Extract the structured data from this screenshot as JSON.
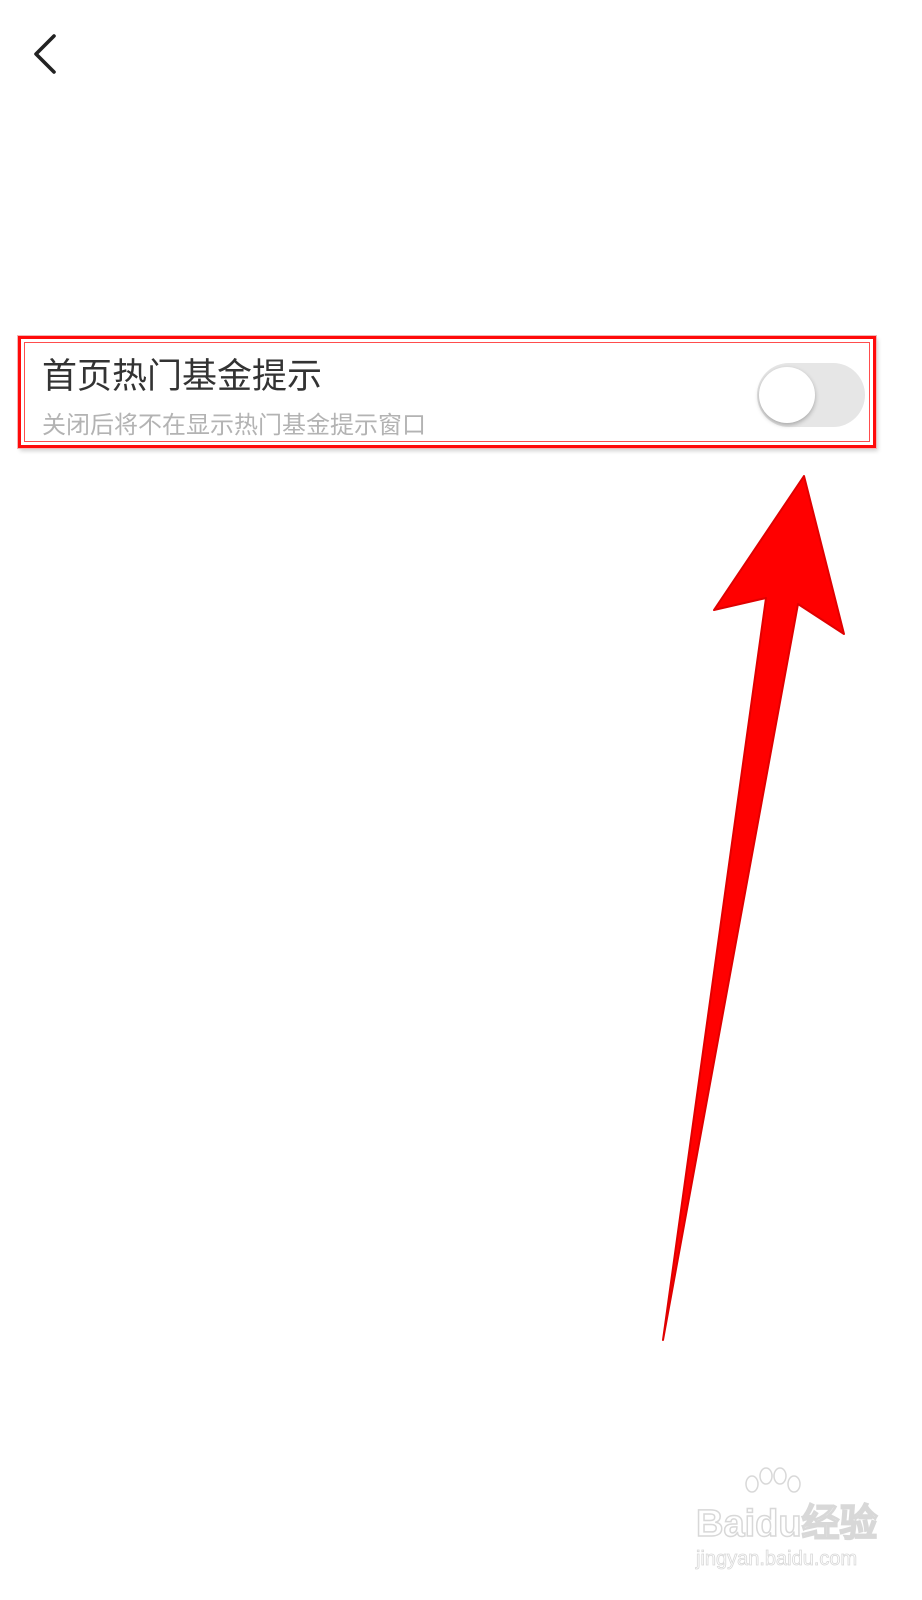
{
  "header": {
    "back_icon": "chevron-left-icon"
  },
  "setting": {
    "title": "首页热门基金提示",
    "description": "关闭后将不在显示热门基金提示窗口",
    "toggle_on": false
  },
  "annotation": {
    "highlight_color": "#ff0000",
    "arrow_color": "#ff0000"
  },
  "watermark": {
    "brand": "Baidu经验",
    "url": "jingyan.baidu.com"
  }
}
